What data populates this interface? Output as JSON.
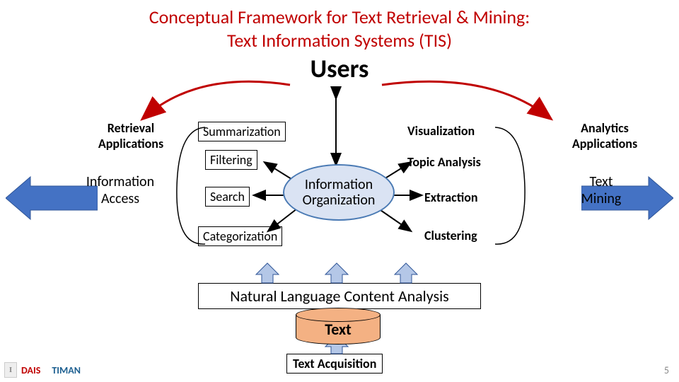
{
  "title_line1": "Conceptual Framework for Text Retrieval & Mining:",
  "title_line2": "Text Information Systems (TIS)",
  "users": "Users",
  "retrieval_apps": "Retrieval\nApplications",
  "analytics_apps": "Analytics\nApplications",
  "info_access": "Information\nAccess",
  "text_mining": "Text\nMining",
  "summarization": "Summarization",
  "visualization": "Visualization",
  "filtering": "Filtering",
  "topic_analysis": "Topic Analysis",
  "search": "Search",
  "extraction": "Extraction",
  "categorization": "Categorization",
  "clustering": "Clustering",
  "info_org": "Information\nOrganization",
  "nlca": "Natural Language Content Analysis",
  "text": "Text",
  "text_acq": "Text Acquisition",
  "page": "5",
  "logo1": "I",
  "logo2": "DAIS",
  "logo3": "TIMAN"
}
